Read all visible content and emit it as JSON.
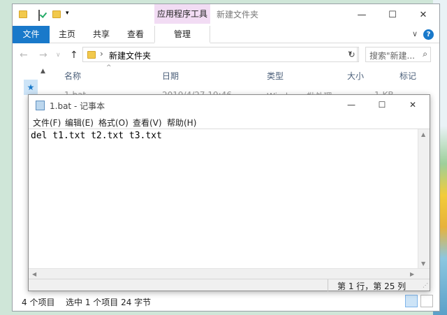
{
  "desktop": {
    "accent": "#1979ca"
  },
  "explorer": {
    "context_tab": "应用程序工具",
    "window_title": "新建文件夹",
    "controls": {
      "minimize": "—",
      "maximize": "☐",
      "close": "✕"
    },
    "tabs": {
      "file": "文件",
      "home": "主页",
      "share": "共享",
      "view": "查看",
      "manage": "管理"
    },
    "ribbon_right": {
      "expand": "∨",
      "help": "?"
    },
    "nav": {
      "back": "←",
      "forward": "→",
      "recent": "∨",
      "up": "↑"
    },
    "address": {
      "sep": "›",
      "path": "新建文件夹",
      "dropdown": "∨",
      "refresh": "↻"
    },
    "search": {
      "placeholder": "搜索\"新建...",
      "icon": "⌕"
    },
    "columns": {
      "name": "名称",
      "date": "日期",
      "type": "类型",
      "size": "大小",
      "tags": "标记"
    },
    "files": [
      {
        "name": "1.bat",
        "date": "2019/4/27 19:46",
        "type": "Windows 批处理",
        "size": "1 KB"
      }
    ],
    "status": {
      "count": "4 个项目",
      "selected": "选中 1 个项目  24 字节"
    }
  },
  "notepad": {
    "title": "1.bat - 记事本",
    "controls": {
      "minimize": "—",
      "maximize": "☐",
      "close": "✕"
    },
    "menu": {
      "file": "文件(F)",
      "edit": "编辑(E)",
      "format": "格式(O)",
      "view": "查看(V)",
      "help": "帮助(H)"
    },
    "content": "del t1.txt t2.txt t3.txt",
    "status": {
      "position": "第 1 行，第 25 列"
    },
    "scroll": {
      "up": "▲",
      "down": "▼",
      "left": "◀",
      "right": "▶"
    },
    "grip": "⋰"
  }
}
